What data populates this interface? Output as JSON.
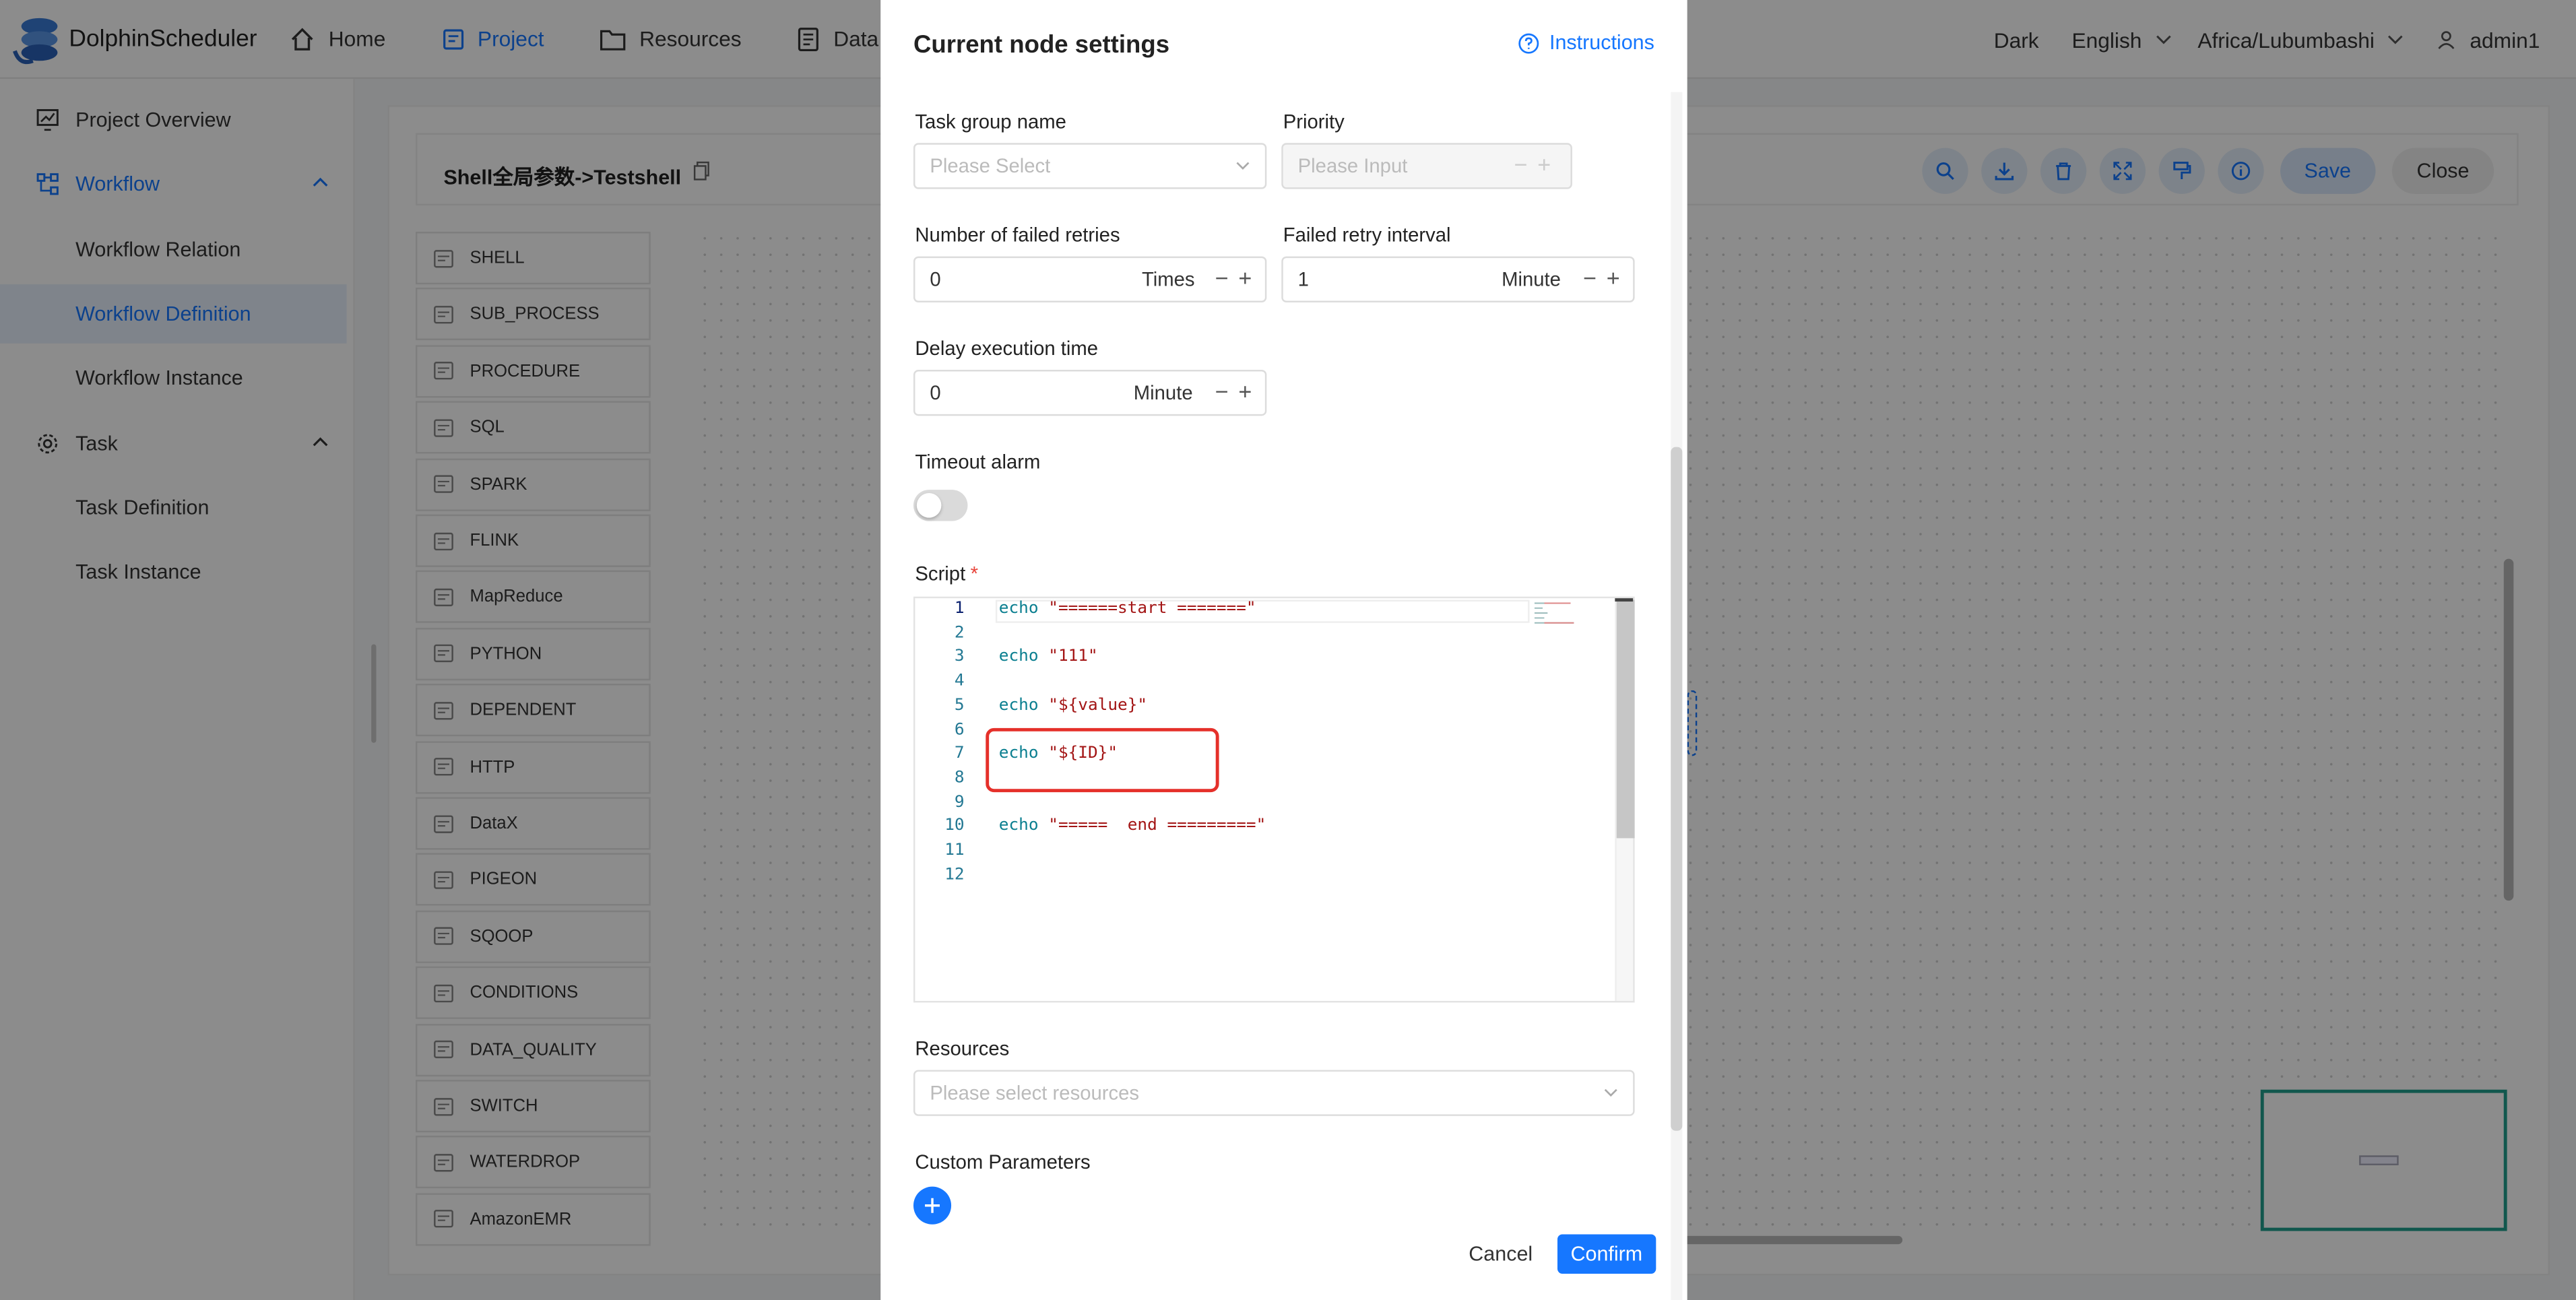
{
  "app": {
    "name": "DolphinScheduler"
  },
  "nav": {
    "home": "Home",
    "project": "Project",
    "resources": "Resources",
    "datasource": "Data"
  },
  "header": {
    "theme": "Dark",
    "language": "English",
    "timezone": "Africa/Lubumbashi",
    "user": "admin1"
  },
  "sidebar": {
    "project_overview": "Project Overview",
    "workflow": "Workflow",
    "workflow_relation": "Workflow Relation",
    "workflow_definition": "Workflow Definition",
    "workflow_instance": "Workflow Instance",
    "task": "Task",
    "task_definition": "Task Definition",
    "task_instance": "Task Instance"
  },
  "toolbar": {
    "title": "Shell全局参数->Testshell",
    "save": "Save",
    "close": "Close",
    "icons": [
      "search-icon",
      "download-icon",
      "delete-icon",
      "fullscreen-icon",
      "format-icon",
      "info-icon"
    ]
  },
  "palette": [
    "SHELL",
    "SUB_PROCESS",
    "PROCEDURE",
    "SQL",
    "SPARK",
    "FLINK",
    "MapReduce",
    "PYTHON",
    "DEPENDENT",
    "HTTP",
    "DataX",
    "PIGEON",
    "SQOOP",
    "CONDITIONS",
    "DATA_QUALITY",
    "SWITCH",
    "WATERDROP",
    "AmazonEMR"
  ],
  "modal": {
    "title": "Current node settings",
    "instructions": "Instructions",
    "task_group_name": {
      "label": "Task group name",
      "placeholder": "Please Select"
    },
    "priority": {
      "label": "Priority",
      "placeholder": "Please Input"
    },
    "failed_retries": {
      "label": "Number of failed retries",
      "value": "0",
      "unit": "Times"
    },
    "retry_interval": {
      "label": "Failed retry interval",
      "value": "1",
      "unit": "Minute"
    },
    "delay_time": {
      "label": "Delay execution time",
      "value": "0",
      "unit": "Minute"
    },
    "timeout_alarm": {
      "label": "Timeout alarm",
      "enabled": false
    },
    "script": {
      "label": "Script",
      "required_mark": "*",
      "line_numbers": [
        "1",
        "2",
        "3",
        "4",
        "5",
        "6",
        "7",
        "8",
        "9",
        "10",
        "11",
        "12"
      ],
      "lines": [
        {
          "kw": "echo",
          "str": "\"======start =======\""
        },
        {
          "kw": "",
          "str": ""
        },
        {
          "kw": "echo",
          "str": "\"111\""
        },
        {
          "kw": "",
          "str": ""
        },
        {
          "kw": "echo",
          "str": "\"${value}\""
        },
        {
          "kw": "",
          "str": ""
        },
        {
          "kw": "echo",
          "str": "\"${ID}\""
        },
        {
          "kw": "",
          "str": ""
        },
        {
          "kw": "",
          "str": ""
        },
        {
          "kw": "echo",
          "str": "\"=====  end =========\""
        },
        {
          "kw": "",
          "str": ""
        },
        {
          "kw": "",
          "str": ""
        }
      ]
    },
    "resources": {
      "label": "Resources",
      "placeholder": "Please select resources"
    },
    "custom_parameters": {
      "label": "Custom Parameters"
    },
    "cancel": "Cancel",
    "confirm": "Confirm"
  },
  "colors": {
    "accent": "#1677ff",
    "highlight": "#e5302a"
  }
}
